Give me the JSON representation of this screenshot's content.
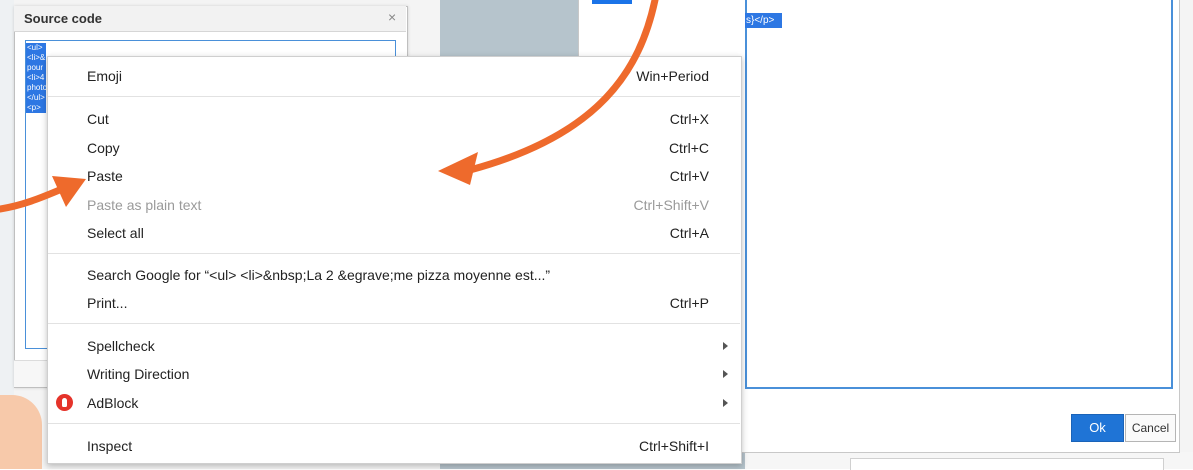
{
  "source_dialog": {
    "title": "Source code",
    "close_glyph": "×",
    "selected_lines": [
      "<ul>",
      "<li>&",
      "pour",
      "<li>4",
      "photo",
      "</ul>",
      "<p>"
    ]
  },
  "right_dialog": {
    "selected_text": "s}</p>",
    "ok_label": "Ok",
    "cancel_label": "Cancel"
  },
  "context_menu": {
    "items": [
      {
        "label": "Emoji",
        "shortcut": "Win+Period"
      },
      {
        "label": "Cut",
        "shortcut": "Ctrl+X"
      },
      {
        "label": "Copy",
        "shortcut": "Ctrl+C"
      },
      {
        "label": "Paste",
        "shortcut": "Ctrl+V"
      },
      {
        "label": "Paste as plain text",
        "shortcut": "Ctrl+Shift+V",
        "disabled": true
      },
      {
        "label": "Select all",
        "shortcut": "Ctrl+A"
      },
      {
        "label": "Search Google for “<ul> <li>&nbsp;La 2 &egrave;me pizza moyenne est...”",
        "shortcut": ""
      },
      {
        "label": "Print...",
        "shortcut": "Ctrl+P"
      },
      {
        "label": "Spellcheck",
        "submenu": true
      },
      {
        "label": "Writing Direction",
        "submenu": true
      },
      {
        "label": "AdBlock",
        "submenu": true,
        "icon": "adblock-icon"
      },
      {
        "label": "Inspect",
        "shortcut": "Ctrl+Shift+I"
      }
    ]
  },
  "colors": {
    "accent": "#1f74d6",
    "annotation_arrow": "#ee6a2c",
    "selection": "#2d77e3",
    "adblock": "#e5332a"
  }
}
